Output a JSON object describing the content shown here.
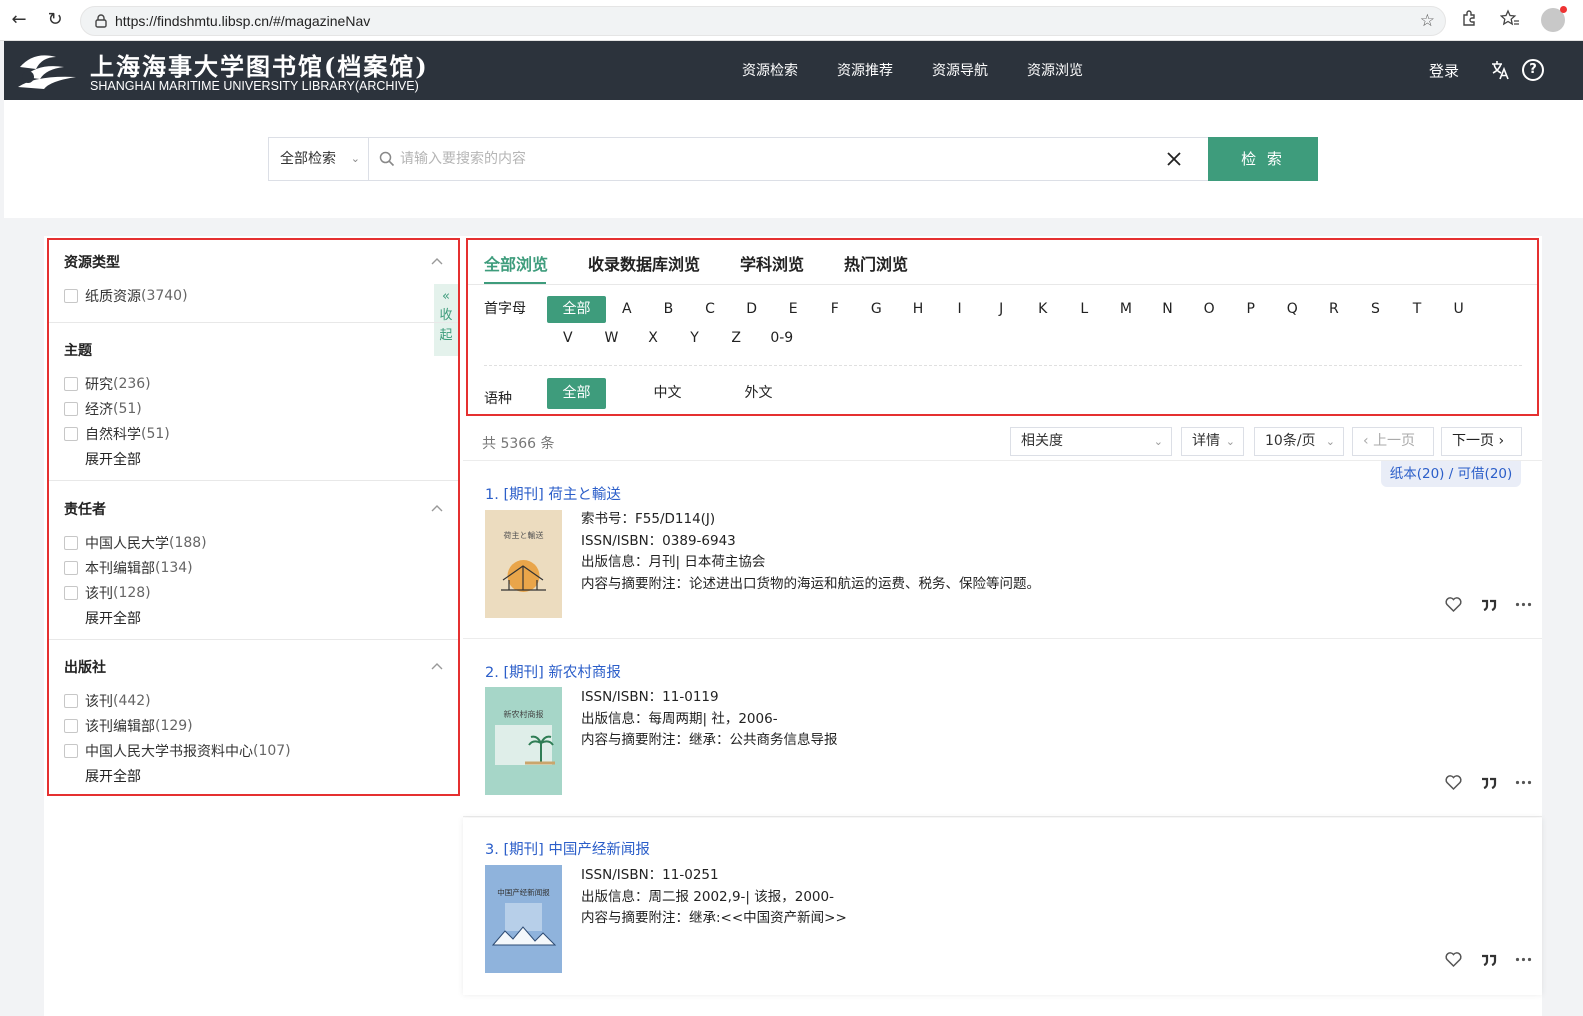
{
  "browser": {
    "url": "https://findshmtu.libsp.cn/#/magazineNav"
  },
  "header": {
    "logo_cn": "上海海事大学图书馆(档案馆)",
    "logo_en": "SHANGHAI MARITIME UNIVERSITY LIBRARY(ARCHIVE)",
    "nav": [
      "资源检索",
      "资源推荐",
      "资源导航",
      "资源浏览"
    ],
    "login": "登录",
    "help": "?"
  },
  "search": {
    "type": "全部检索",
    "placeholder": "请输入要搜索的内容",
    "button": "检 索"
  },
  "filters": {
    "collapse_label": "收起",
    "groups": [
      {
        "title": "资源类型",
        "items": [
          {
            "label": "纸质资源",
            "count": "(3740)"
          }
        ],
        "expand": ""
      },
      {
        "title": "主题",
        "items": [
          {
            "label": "研究",
            "count": "(236)"
          },
          {
            "label": "经济",
            "count": "(51)"
          },
          {
            "label": "自然科学",
            "count": "(51)"
          }
        ],
        "expand": "展开全部"
      },
      {
        "title": "责任者",
        "items": [
          {
            "label": "中国人民大学",
            "count": "(188)"
          },
          {
            "label": "本刊编辑部",
            "count": "(134)"
          },
          {
            "label": "该刊",
            "count": "(128)"
          }
        ],
        "expand": "展开全部"
      },
      {
        "title": "出版社",
        "items": [
          {
            "label": "该刊",
            "count": "(442)"
          },
          {
            "label": "该刊编辑部",
            "count": "(129)"
          },
          {
            "label": "中国人民大学书报资料中心",
            "count": "(107)"
          }
        ],
        "expand": "展开全部"
      }
    ]
  },
  "browse": {
    "tabs": [
      "全部浏览",
      "收录数据库浏览",
      "学科浏览",
      "热门浏览"
    ],
    "initial_label": "首字母",
    "letters": [
      "全部",
      "A",
      "B",
      "C",
      "D",
      "E",
      "F",
      "G",
      "H",
      "I",
      "J",
      "K",
      "L",
      "M",
      "N",
      "O",
      "P",
      "Q",
      "R",
      "S",
      "T",
      "U",
      "V",
      "W",
      "X",
      "Y",
      "Z",
      "0-9"
    ],
    "lang_label": "语种",
    "langs": [
      "全部",
      "中文",
      "外文"
    ]
  },
  "toolbar": {
    "total": "共 5366 条",
    "sort": "相关度",
    "view": "详情",
    "page_size": "10条/页",
    "prev": "上一页",
    "next": "下一页"
  },
  "results": [
    {
      "title": "1. [期刊] 荷主と輸送",
      "badge": "纸本(20) / 可借(20)",
      "cover_text": "荷主と輸送",
      "meta": [
        "索书号：F55/D114(J)",
        "ISSN/ISBN：0389-6943",
        "出版信息：月刊|  日本荷主協会",
        "内容与摘要附注：论述进出口货物的海运和航运的运费、税务、保险等问题。"
      ]
    },
    {
      "title": "2. [期刊] 新农村商报",
      "cover_text": "新农村商报",
      "meta": [
        "ISSN/ISBN：11-0119",
        "出版信息：每周两期|  社，2006-",
        "内容与摘要附注：继承：公共商务信息导报"
      ]
    },
    {
      "title": "3. [期刊] 中国产经新闻报",
      "cover_text": "中国产经新闻报",
      "meta": [
        "ISSN/ISBN：11-0251",
        "出版信息：周二报 2002,9-|  该报，2000-",
        "内容与摘要附注：继承:<<中国资产新闻>>"
      ]
    }
  ]
}
